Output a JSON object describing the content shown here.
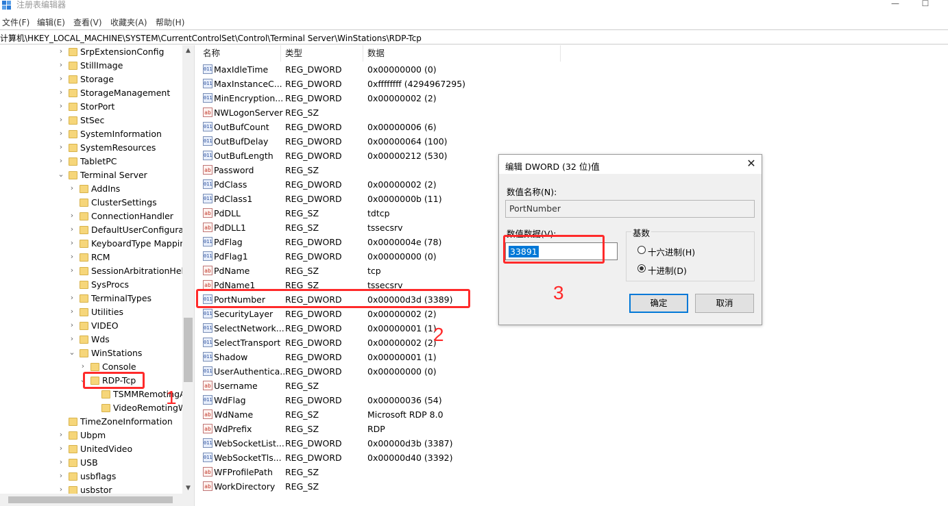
{
  "window": {
    "title": "注册表编辑器",
    "minimize_glyph": "—",
    "maximize_glyph": "☐"
  },
  "menu": [
    "文件(F)",
    "编辑(E)",
    "查看(V)",
    "收藏夹(A)",
    "帮助(H)"
  ],
  "address": "计算机\\HKEY_LOCAL_MACHINE\\SYSTEM\\CurrentControlSet\\Control\\Terminal Server\\WinStations\\RDP-Tcp",
  "tree": {
    "items": [
      {
        "label": "SrpExtensionConfig",
        "level": 0,
        "chevron": "›"
      },
      {
        "label": "StillImage",
        "level": 0,
        "chevron": "›"
      },
      {
        "label": "Storage",
        "level": 0,
        "chevron": "›"
      },
      {
        "label": "StorageManagement",
        "level": 0,
        "chevron": "›"
      },
      {
        "label": "StorPort",
        "level": 0,
        "chevron": "›"
      },
      {
        "label": "StSec",
        "level": 0,
        "chevron": "›"
      },
      {
        "label": "SystemInformation",
        "level": 0,
        "chevron": "›"
      },
      {
        "label": "SystemResources",
        "level": 0,
        "chevron": "›"
      },
      {
        "label": "TabletPC",
        "level": 0,
        "chevron": "›"
      },
      {
        "label": "Terminal Server",
        "level": 0,
        "chevron": "⌄"
      },
      {
        "label": "AddIns",
        "level": 1,
        "chevron": "›"
      },
      {
        "label": "ClusterSettings",
        "level": 1,
        "chevron": ""
      },
      {
        "label": "ConnectionHandler",
        "level": 1,
        "chevron": "›"
      },
      {
        "label": "DefaultUserConfigurati",
        "level": 1,
        "chevron": "›"
      },
      {
        "label": "KeyboardType Mappin",
        "level": 1,
        "chevron": "›"
      },
      {
        "label": "RCM",
        "level": 1,
        "chevron": "›"
      },
      {
        "label": "SessionArbitrationHelp",
        "level": 1,
        "chevron": "›"
      },
      {
        "label": "SysProcs",
        "level": 1,
        "chevron": ""
      },
      {
        "label": "TerminalTypes",
        "level": 1,
        "chevron": "›"
      },
      {
        "label": "Utilities",
        "level": 1,
        "chevron": "›"
      },
      {
        "label": "VIDEO",
        "level": 1,
        "chevron": "›"
      },
      {
        "label": "Wds",
        "level": 1,
        "chevron": "›"
      },
      {
        "label": "WinStations",
        "level": 1,
        "chevron": "⌄"
      },
      {
        "label": "Console",
        "level": 2,
        "chevron": "›"
      },
      {
        "label": "RDP-Tcp",
        "level": 2,
        "chevron": "⌄"
      },
      {
        "label": "TSMMRemotingA",
        "level": 3,
        "chevron": ""
      },
      {
        "label": "VideoRemotingW",
        "level": 3,
        "chevron": ""
      },
      {
        "label": "TimeZoneInformation",
        "level": 0,
        "chevron": ""
      },
      {
        "label": "Ubpm",
        "level": 0,
        "chevron": "›"
      },
      {
        "label": "UnitedVideo",
        "level": 0,
        "chevron": "›"
      },
      {
        "label": "USB",
        "level": 0,
        "chevron": "›"
      },
      {
        "label": "usbflags",
        "level": 0,
        "chevron": "›"
      },
      {
        "label": "usbstor",
        "level": 0,
        "chevron": "›"
      }
    ],
    "scroll_up": "▲",
    "scroll_down": "▼"
  },
  "list": {
    "columns": [
      "名称",
      "类型",
      "数据"
    ],
    "rows": [
      {
        "icon": "dword-icon",
        "icon_text": "011",
        "name": "MaxIdleTime",
        "type": "REG_DWORD",
        "data": "0x00000000 (0)"
      },
      {
        "icon": "dword-icon",
        "icon_text": "011",
        "name": "MaxInstanceC...",
        "type": "REG_DWORD",
        "data": "0xffffffff (4294967295)"
      },
      {
        "icon": "dword-icon",
        "icon_text": "011",
        "name": "MinEncryption...",
        "type": "REG_DWORD",
        "data": "0x00000002 (2)"
      },
      {
        "icon": "string-icon",
        "icon_text": "ab",
        "name": "NWLogonServer",
        "type": "REG_SZ",
        "data": ""
      },
      {
        "icon": "dword-icon",
        "icon_text": "011",
        "name": "OutBufCount",
        "type": "REG_DWORD",
        "data": "0x00000006 (6)"
      },
      {
        "icon": "dword-icon",
        "icon_text": "011",
        "name": "OutBufDelay",
        "type": "REG_DWORD",
        "data": "0x00000064 (100)"
      },
      {
        "icon": "dword-icon",
        "icon_text": "011",
        "name": "OutBufLength",
        "type": "REG_DWORD",
        "data": "0x00000212 (530)"
      },
      {
        "icon": "string-icon",
        "icon_text": "ab",
        "name": "Password",
        "type": "REG_SZ",
        "data": ""
      },
      {
        "icon": "dword-icon",
        "icon_text": "011",
        "name": "PdClass",
        "type": "REG_DWORD",
        "data": "0x00000002 (2)"
      },
      {
        "icon": "dword-icon",
        "icon_text": "011",
        "name": "PdClass1",
        "type": "REG_DWORD",
        "data": "0x0000000b (11)"
      },
      {
        "icon": "string-icon",
        "icon_text": "ab",
        "name": "PdDLL",
        "type": "REG_SZ",
        "data": "tdtcp"
      },
      {
        "icon": "string-icon",
        "icon_text": "ab",
        "name": "PdDLL1",
        "type": "REG_SZ",
        "data": "tssecsrv"
      },
      {
        "icon": "dword-icon",
        "icon_text": "011",
        "name": "PdFlag",
        "type": "REG_DWORD",
        "data": "0x0000004e (78)"
      },
      {
        "icon": "dword-icon",
        "icon_text": "011",
        "name": "PdFlag1",
        "type": "REG_DWORD",
        "data": "0x00000000 (0)"
      },
      {
        "icon": "string-icon",
        "icon_text": "ab",
        "name": "PdName",
        "type": "REG_SZ",
        "data": "tcp"
      },
      {
        "icon": "string-icon",
        "icon_text": "ab",
        "name": "PdName1",
        "type": "REG_SZ",
        "data": "tssecsrv"
      },
      {
        "icon": "dword-icon",
        "icon_text": "011",
        "name": "PortNumber",
        "type": "REG_DWORD",
        "data": "0x00000d3d (3389)"
      },
      {
        "icon": "dword-icon",
        "icon_text": "011",
        "name": "SecurityLayer",
        "type": "REG_DWORD",
        "data": "0x00000002 (2)"
      },
      {
        "icon": "dword-icon",
        "icon_text": "011",
        "name": "SelectNetwork...",
        "type": "REG_DWORD",
        "data": "0x00000001 (1)"
      },
      {
        "icon": "dword-icon",
        "icon_text": "011",
        "name": "SelectTransport",
        "type": "REG_DWORD",
        "data": "0x00000002 (2)"
      },
      {
        "icon": "dword-icon",
        "icon_text": "011",
        "name": "Shadow",
        "type": "REG_DWORD",
        "data": "0x00000001 (1)"
      },
      {
        "icon": "dword-icon",
        "icon_text": "011",
        "name": "UserAuthentica...",
        "type": "REG_DWORD",
        "data": "0x00000000 (0)"
      },
      {
        "icon": "string-icon",
        "icon_text": "ab",
        "name": "Username",
        "type": "REG_SZ",
        "data": ""
      },
      {
        "icon": "dword-icon",
        "icon_text": "011",
        "name": "WdFlag",
        "type": "REG_DWORD",
        "data": "0x00000036 (54)"
      },
      {
        "icon": "string-icon",
        "icon_text": "ab",
        "name": "WdName",
        "type": "REG_SZ",
        "data": "Microsoft RDP 8.0"
      },
      {
        "icon": "string-icon",
        "icon_text": "ab",
        "name": "WdPrefix",
        "type": "REG_SZ",
        "data": "RDP"
      },
      {
        "icon": "dword-icon",
        "icon_text": "011",
        "name": "WebSocketList...",
        "type": "REG_DWORD",
        "data": "0x00000d3b (3387)"
      },
      {
        "icon": "dword-icon",
        "icon_text": "011",
        "name": "WebSocketTls...",
        "type": "REG_DWORD",
        "data": "0x00000d40 (3392)"
      },
      {
        "icon": "string-icon",
        "icon_text": "ab",
        "name": "WFProfilePath",
        "type": "REG_SZ",
        "data": ""
      },
      {
        "icon": "string-icon",
        "icon_text": "ab",
        "name": "WorkDirectory",
        "type": "REG_SZ",
        "data": ""
      }
    ]
  },
  "annotations": {
    "step1": "1",
    "step2": "2",
    "step3": "3",
    "color": "#ff2a2a"
  },
  "dialog": {
    "title": "编辑 DWORD (32 位)值",
    "close_glyph": "✕",
    "name_label": "数值名称(N):",
    "name_value": "PortNumber",
    "value_label": "数值数据(V):",
    "value": "33891",
    "base_label": "基数",
    "hex_label": "十六进制(H)",
    "dec_label": "十进制(D)",
    "selected_base": "decimal",
    "ok_label": "确定",
    "cancel_label": "取消"
  }
}
